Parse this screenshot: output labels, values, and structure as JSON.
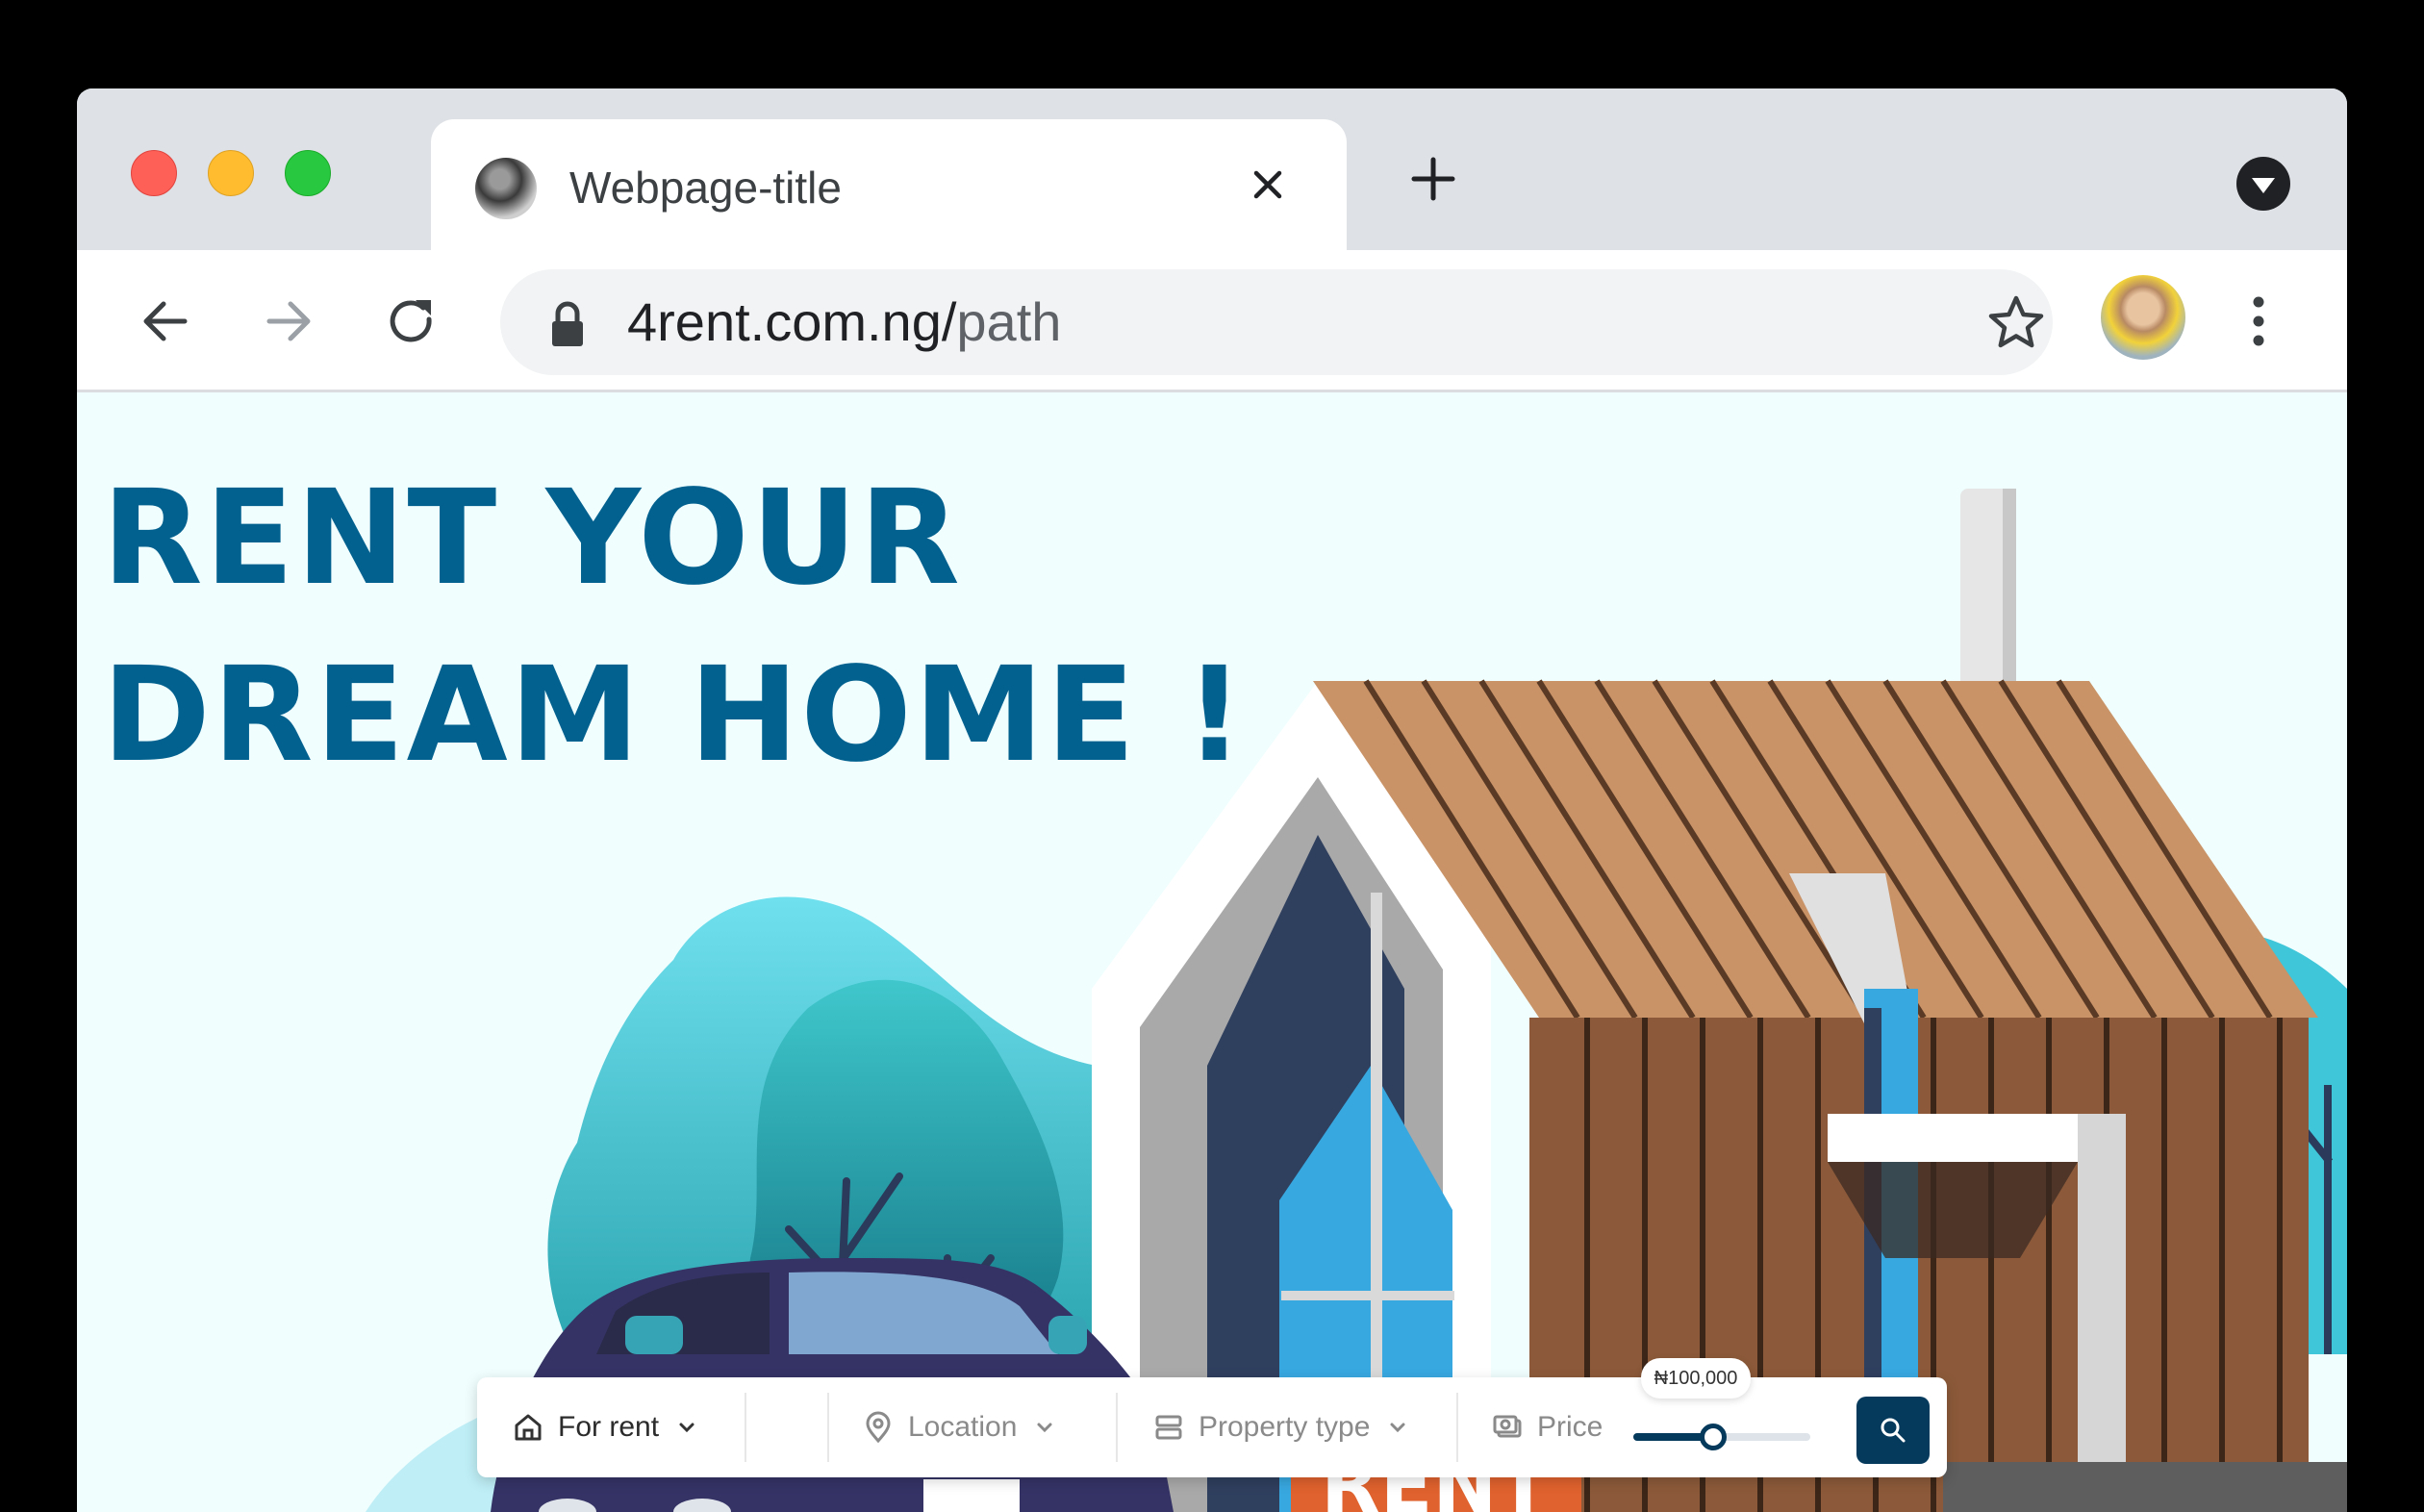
{
  "browser": {
    "tab": {
      "title": "Webpage-title"
    },
    "address": {
      "domain": "4rent.com.ng/",
      "path": "path"
    }
  },
  "hero": {
    "headline_line1": "RENT YOUR",
    "headline_line2": "DREAM HOME !",
    "sign_text": "RENT"
  },
  "search_bar": {
    "listing_type": "For rent",
    "location_placeholder": "Location",
    "property_type_placeholder": "Property type",
    "price_label": "Price",
    "price_value": "₦100,000",
    "price_slider_fraction": 0.45
  },
  "colors": {
    "headline": "#03618f",
    "accent_dark": "#063a5c",
    "page_background": "#f0fefe",
    "inactive_text": "#8a8a8a"
  },
  "icons": [
    "close-icon",
    "plus-icon",
    "tab-search-icon",
    "back-arrow-icon",
    "forward-arrow-icon",
    "reload-icon",
    "lock-icon",
    "star-icon",
    "more-icon",
    "home-icon",
    "chevron-down-icon",
    "location-pin-icon",
    "stack-icon",
    "money-icon",
    "search-icon"
  ]
}
